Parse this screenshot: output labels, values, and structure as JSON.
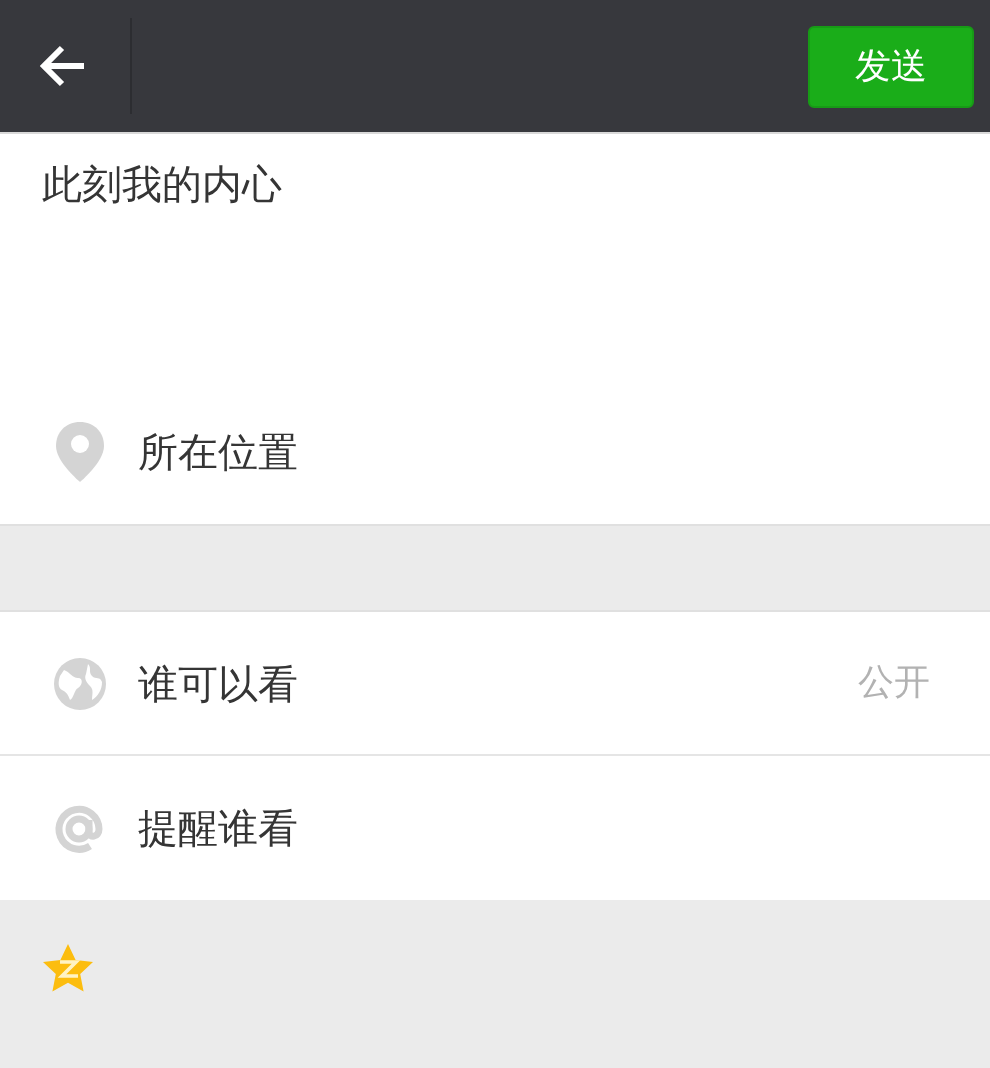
{
  "header": {
    "send_button": "发送"
  },
  "post_text": "此刻我的内心",
  "rows": [
    {
      "kind": "location",
      "label": "所在位置"
    },
    {
      "kind": "gap"
    },
    {
      "kind": "visibility",
      "label": "谁可以看",
      "value": "公开"
    },
    {
      "kind": "mention",
      "label": "提醒谁看"
    }
  ],
  "footer": {
    "kind": "qzone"
  }
}
